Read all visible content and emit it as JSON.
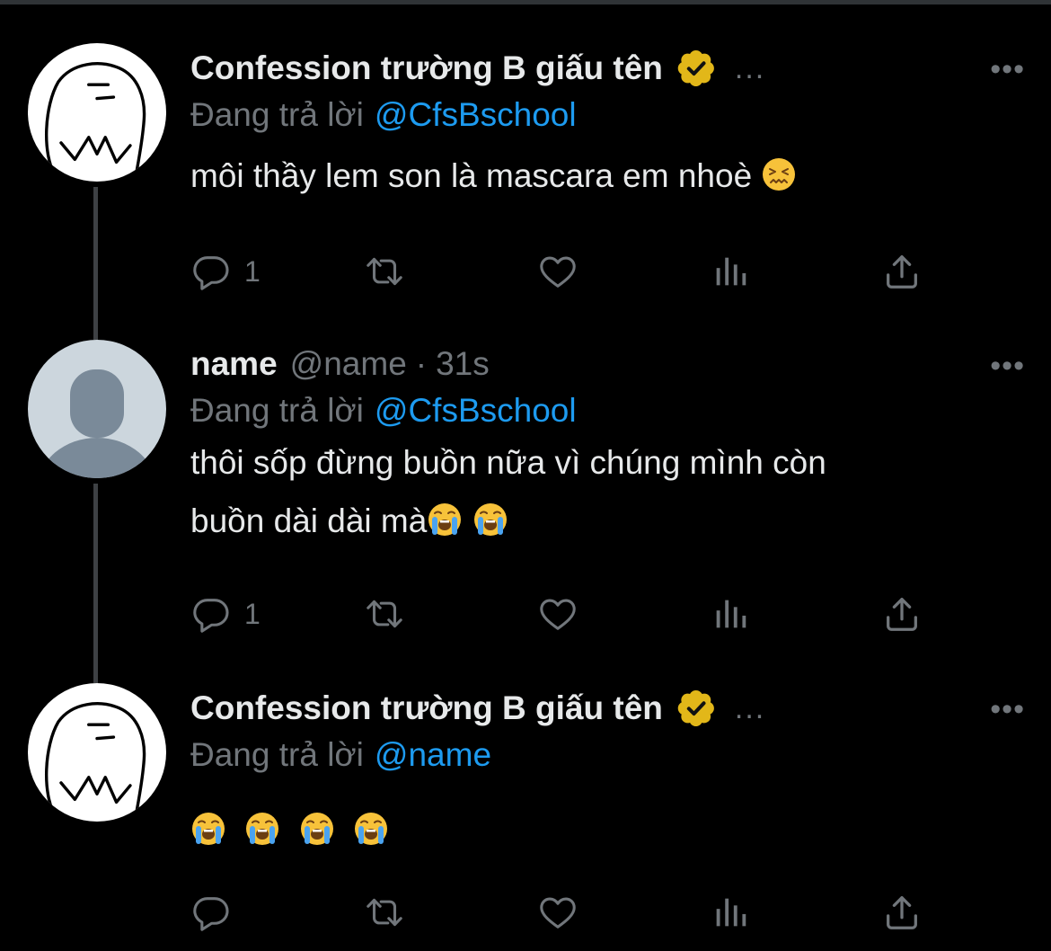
{
  "tweets": [
    {
      "display_name": "Confession trường B giấu tên",
      "verified": true,
      "header_ellipsis": "...",
      "more": "•••",
      "reply_prefix": "Đang trả lời",
      "reply_mention": "@CfsBschool",
      "text": "môi thầy lem son là mascara em nhoè",
      "emojis": [
        "confounded-face"
      ],
      "reply_count": "1",
      "avatar": "meme-face"
    },
    {
      "display_name": "name",
      "handle": "@name",
      "separator": "·",
      "time": "31s",
      "more": "•••",
      "reply_prefix": "Đang trả lời",
      "reply_mention": "@CfsBschool",
      "text_line1": "thôi sốp đừng buồn nữa vì chúng mình còn",
      "text_line2": "buồn dài dài mà",
      "emojis": [
        "loudly-crying-face",
        "loudly-crying-face"
      ],
      "reply_count": "1",
      "avatar": "default-profile"
    },
    {
      "display_name": "Confession trường B giấu tên",
      "verified": true,
      "header_ellipsis": "...",
      "more": "•••",
      "reply_prefix": "Đang trả lời",
      "reply_mention": "@name",
      "emojis": [
        "loudly-crying-face",
        "loudly-crying-face",
        "loudly-crying-face",
        "loudly-crying-face"
      ],
      "reply_count": "",
      "avatar": "meme-face"
    }
  ],
  "actions": [
    "reply-icon",
    "retweet-icon",
    "like-icon",
    "analytics-icon",
    "share-icon"
  ],
  "colors": {
    "background": "#000000",
    "text": "#e7e9ea",
    "muted": "#71767b",
    "link": "#1d9bf0",
    "verified_gold": "#e2b719",
    "thread_line": "#3e4144"
  }
}
